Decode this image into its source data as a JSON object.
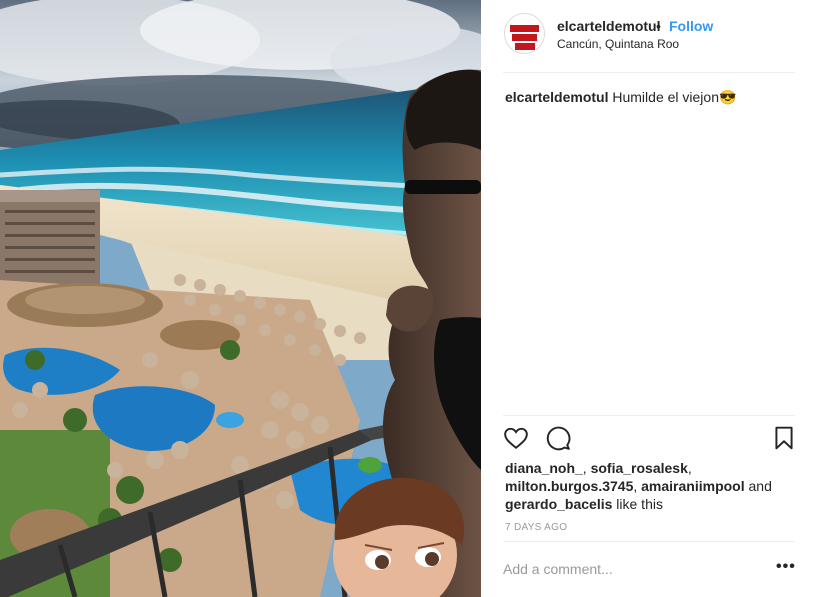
{
  "post": {
    "username": "elcarteldemotul",
    "separator": "•",
    "follow_label": "Follow",
    "location": "Cancún, Quintana Roo",
    "caption_user": "elcarteldemotul",
    "caption_text": "Humilde el viejon😎",
    "likes": {
      "user1": "diana_noh_",
      "user2": "sofia_rosalesk",
      "user3": "milton.burgos.3745",
      "user4": "amairaniimpool",
      "and_text": "and",
      "user5": "gerardo_bacelis",
      "suffix": "like this",
      "comma": ","
    },
    "timestamp": "7 DAYS AGO",
    "comment_placeholder": "Add a comment...",
    "more_label": "•••"
  },
  "icons": {
    "like": "heart-icon",
    "comment": "comment-icon",
    "save": "bookmark-icon",
    "more": "more-options-icon"
  },
  "colors": {
    "follow": "#3897f0",
    "text": "#262626",
    "muted": "#999999",
    "avatar_brand": "#c4161c"
  }
}
